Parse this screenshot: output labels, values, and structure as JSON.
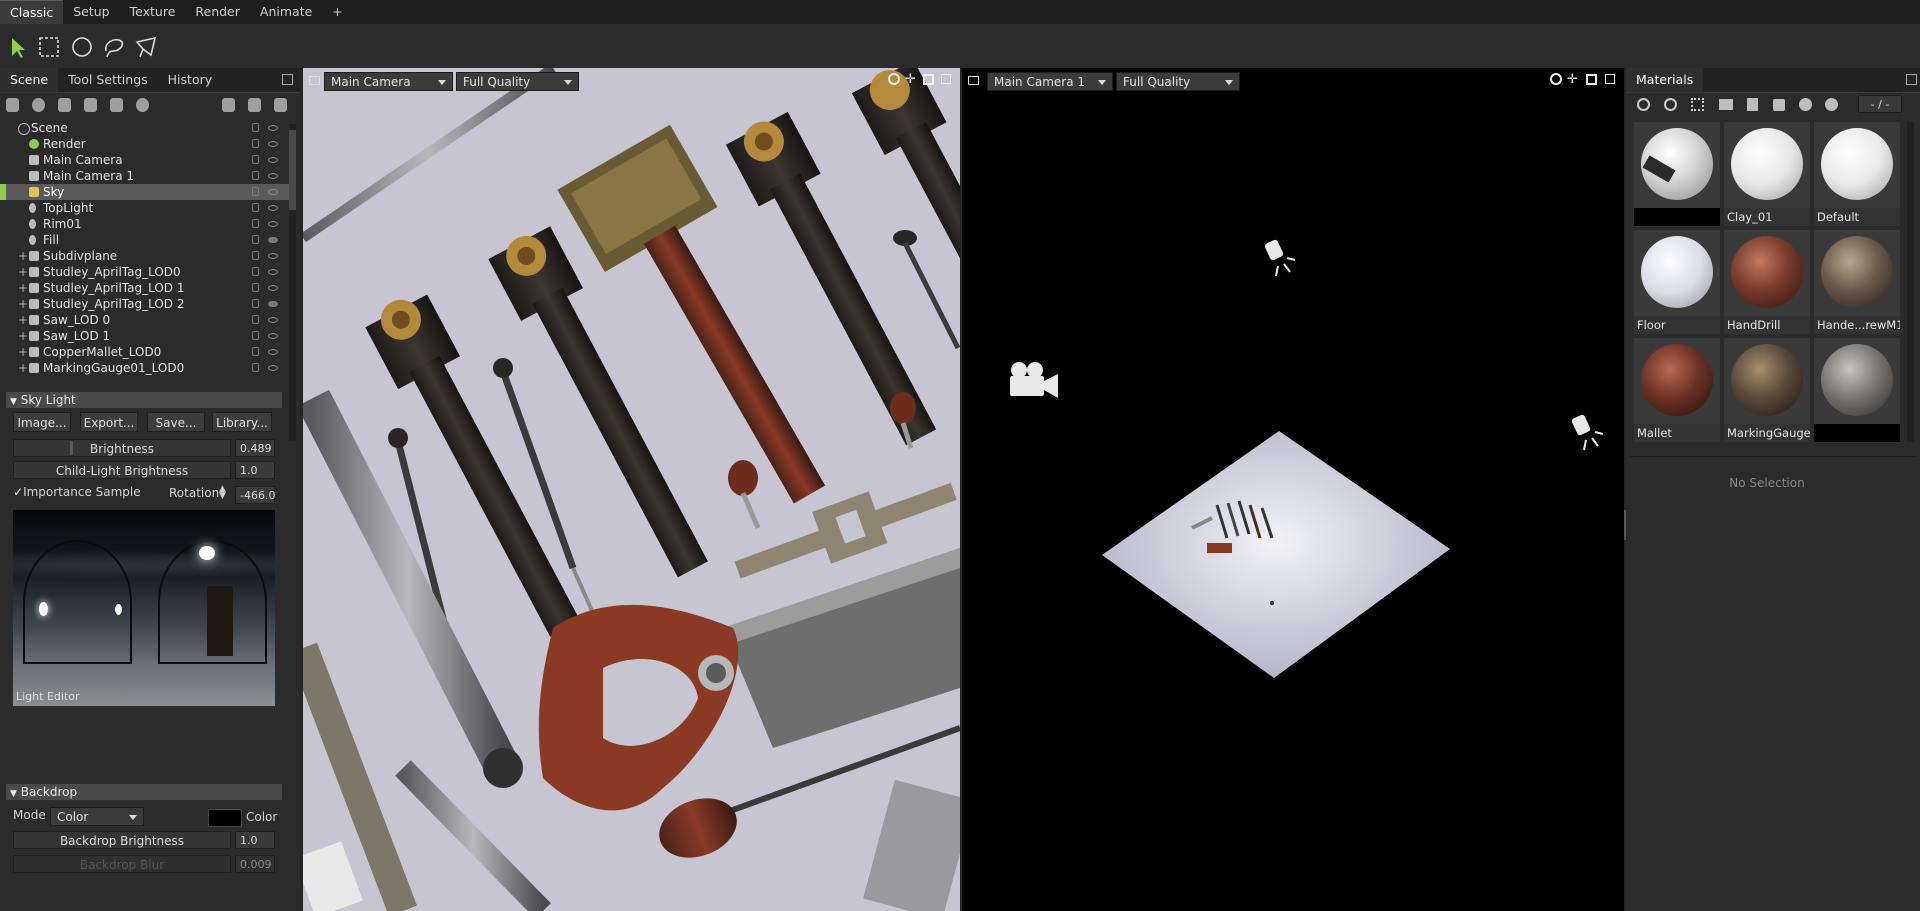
{
  "menu": {
    "tabs": [
      "Classic",
      "Setup",
      "Texture",
      "Render",
      "Animate",
      "+"
    ]
  },
  "scene_panel": {
    "tabs": [
      "Scene",
      "Tool Settings",
      "History"
    ],
    "tree": [
      {
        "label": "Scene"
      },
      {
        "label": "Render"
      },
      {
        "label": "Main Camera"
      },
      {
        "label": "Main Camera 1"
      },
      {
        "label": "Sky",
        "selected": true
      },
      {
        "label": "TopLight"
      },
      {
        "label": "Rim01"
      },
      {
        "label": "Fill"
      },
      {
        "label": "Subdivplane"
      },
      {
        "label": "Studley_AprilTag_LOD0"
      },
      {
        "label": "Studley_AprilTag_LOD 1"
      },
      {
        "label": "Studley_AprilTag_LOD 2"
      },
      {
        "label": "Saw_LOD 0"
      },
      {
        "label": "Saw_LOD 1"
      },
      {
        "label": "CopperMallet_LOD0"
      },
      {
        "label": "MarkingGauge01_LOD0"
      }
    ]
  },
  "sky_light": {
    "title": "Sky Light",
    "buttons": [
      "Image...",
      "Export...",
      "Save...",
      "Library..."
    ],
    "brightness_label": "Brightness",
    "brightness_value": "0.489",
    "child_brightness_label": "Child-Light Brightness",
    "child_brightness_value": "1.0",
    "importance_label": "Importance Sample",
    "rotation_label": "Rotation",
    "rotation_value": "-466.0",
    "preview_caption": "Light Editor"
  },
  "backdrop": {
    "title": "Backdrop",
    "mode_label": "Mode",
    "mode_value": "Color",
    "color_label": "Color",
    "color_swatch": "#000000",
    "brightness_label": "Backdrop Brightness",
    "brightness_value": "1.0",
    "blur_label": "Backdrop Blur",
    "blur_value": "0.009"
  },
  "viewport_left": {
    "camera": "Main Camera",
    "quality": "Full Quality"
  },
  "viewport_right": {
    "camera": "Main Camera 1",
    "quality": "Full Quality"
  },
  "materials": {
    "title": "Materials",
    "page_field": "- / -",
    "items": [
      {
        "name": "",
        "color": "#e8e8e8",
        "tex": "stripes"
      },
      {
        "name": "Clay_01",
        "color": "#eeeeee"
      },
      {
        "name": "Default",
        "color": "#f0f0f0"
      },
      {
        "name": "Floor",
        "color": "#e3e3ea"
      },
      {
        "name": "HandDrill",
        "color": "#7a3b2c"
      },
      {
        "name": "Hande...rewM1",
        "color": "#6b5a4a"
      },
      {
        "name": "Mallet",
        "color": "#6e3226"
      },
      {
        "name": "MarkingGauge",
        "color": "#5a4a3a"
      },
      {
        "name": "",
        "color": "#7a7672"
      }
    ],
    "no_selection": "No Selection"
  },
  "colors": {
    "accent_green": "#8cd14a",
    "panel": "#2b2b2b"
  }
}
